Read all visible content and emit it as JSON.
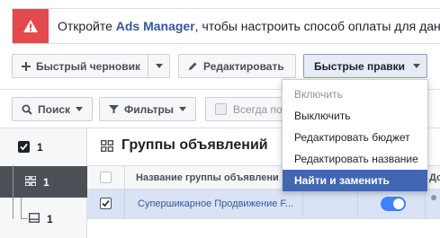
{
  "alert": {
    "text_before": "Откройте ",
    "link": "Ads Manager",
    "text_after": ", чтобы настроить способ оплаты для дан"
  },
  "toolbar": {
    "draft_label": "Быстрый черновик",
    "edit_label": "Редактировать",
    "quick_edit_label": "Быстрые правки"
  },
  "filters": {
    "search_label": "Поиск",
    "filters_label": "Фильтры",
    "always_label": "Всегда по"
  },
  "tree": {
    "campaign_count": "1",
    "adset_count": "1",
    "ad_count": "1"
  },
  "main": {
    "title": "Группы объявлений",
    "col_name": "Название группы объявлени",
    "col_delivery": "До",
    "row_name": "Супершикарное Продвижение F..."
  },
  "menu": {
    "items": [
      {
        "label": "Включить",
        "state": "disabled"
      },
      {
        "label": "Выключить",
        "state": "normal"
      },
      {
        "label": "Редактировать бюджет",
        "state": "normal"
      },
      {
        "label": "Редактировать название",
        "state": "normal"
      },
      {
        "label": "Найти и заменить",
        "state": "highlighted"
      }
    ]
  },
  "colors": {
    "alert_red": "#e4494d",
    "link_blue": "#365899",
    "menu_highlight": "#4267b2",
    "toggle_on": "#4080ff",
    "selected_row": "#d9e3f5"
  }
}
